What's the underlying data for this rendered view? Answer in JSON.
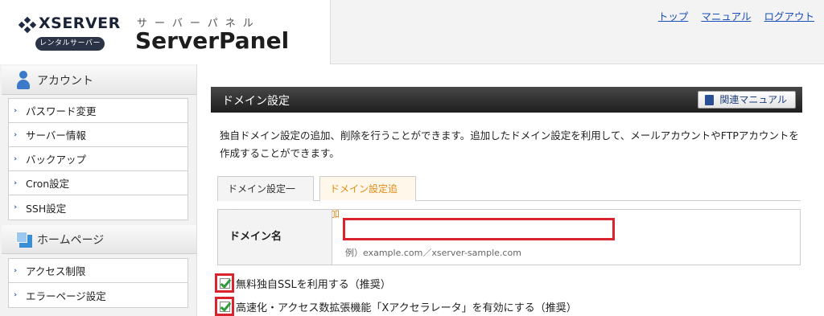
{
  "header": {
    "brand": "XSERVER",
    "brand_badge": "レンタルサーバー",
    "panel_kana": "サーバーパネル",
    "panel_title": "ServerPanel",
    "links": [
      "トップ",
      "マニュアル",
      "ログアウト"
    ]
  },
  "sidebar": {
    "sections": [
      {
        "title": "アカウント",
        "icon": "user-icon",
        "items": [
          "パスワード変更",
          "サーバー情報",
          "バックアップ",
          "Cron設定",
          "SSH設定"
        ]
      },
      {
        "title": "ホームページ",
        "icon": "homepage-icon",
        "items": [
          "アクセス制限",
          "エラーページ設定"
        ]
      }
    ]
  },
  "main": {
    "section_title": "ドメイン設定",
    "manual_button": "関連マニュアル",
    "description": "独自ドメイン設定の追加、削除を行うことができます。追加したドメイン設定を利用して、メールアカウントやFTPアカウントを作成することができます。",
    "tabs": [
      {
        "label": "ドメイン設定一覧",
        "active": false
      },
      {
        "label": "ドメイン設定追加",
        "active": true
      }
    ],
    "form": {
      "domain_label": "ドメイン名",
      "domain_value": "",
      "domain_hint": "例）example.com／xserver-sample.com"
    },
    "options": [
      {
        "label": "無料独自SSLを利用する（推奨）",
        "checked": true
      },
      {
        "label": "高速化・アクセス数拡張機能「Xアクセラレータ」を有効にする（推奨）",
        "checked": true
      }
    ]
  },
  "colors": {
    "header_bar": "#1e1e1e",
    "active_tab_text": "#e08a17",
    "highlight_border": "#d9232e",
    "link": "#1a4fb8",
    "check": "#2e9c3a"
  }
}
